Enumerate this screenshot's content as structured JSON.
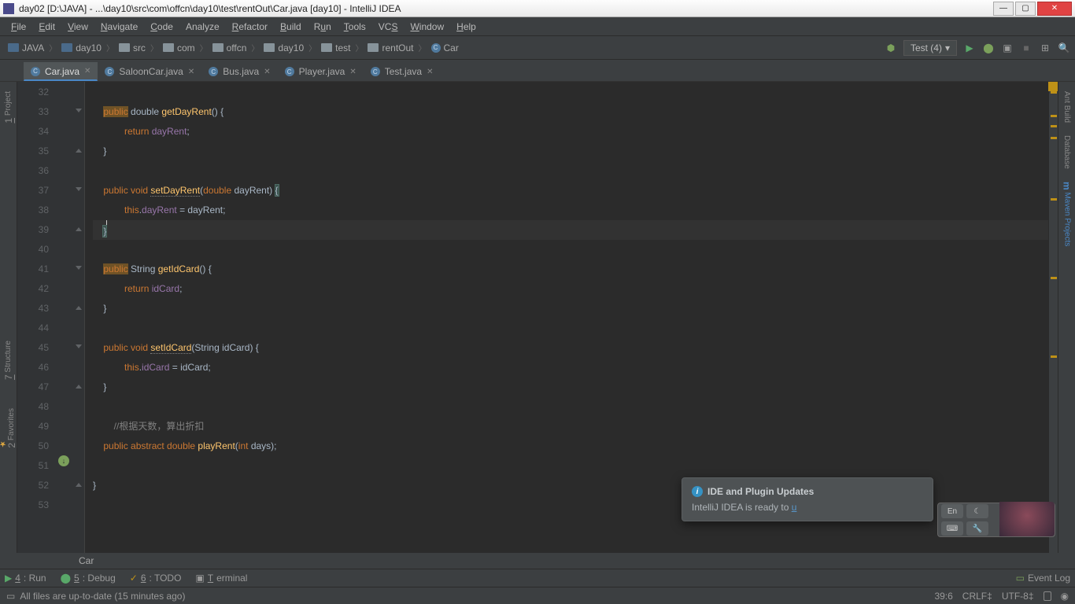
{
  "titlebar": {
    "text": "day02 [D:\\JAVA] - ...\\day10\\src\\com\\offcn\\day10\\test\\rentOut\\Car.java [day10] - IntelliJ IDEA"
  },
  "menubar": [
    {
      "key": "F",
      "label": "File"
    },
    {
      "key": "E",
      "label": "Edit"
    },
    {
      "key": "V",
      "label": "View"
    },
    {
      "key": "N",
      "label": "Navigate"
    },
    {
      "key": "C",
      "label": "Code"
    },
    {
      "key": "",
      "label": "Analyze"
    },
    {
      "key": "R",
      "label": "Refactor"
    },
    {
      "key": "B",
      "label": "Build"
    },
    {
      "key": "u",
      "label": "Run"
    },
    {
      "key": "T",
      "label": "Tools"
    },
    {
      "key": "S",
      "label": "VCS"
    },
    {
      "key": "W",
      "label": "Window"
    },
    {
      "key": "H",
      "label": "Help"
    }
  ],
  "breadcrumbs": [
    "JAVA",
    "day10",
    "src",
    "com",
    "offcn",
    "day10",
    "test",
    "rentOut",
    "Car"
  ],
  "run_config": "Test (4)",
  "tabs": [
    {
      "label": "Car.java",
      "active": true
    },
    {
      "label": "SaloonCar.java",
      "active": false
    },
    {
      "label": "Bus.java",
      "active": false
    },
    {
      "label": "Player.java",
      "active": false
    },
    {
      "label": "Test.java",
      "active": false
    }
  ],
  "lines": {
    "32": "",
    "33": {
      "tokens": [
        {
          "t": "public",
          "c": "kw hl"
        },
        {
          "t": " double ",
          "c": "type"
        },
        {
          "t": "getDayRent",
          "c": "method"
        },
        {
          "t": "() {",
          "c": "paren"
        }
      ]
    },
    "34": {
      "tokens": [
        {
          "t": "        return ",
          "c": "kw"
        },
        {
          "t": "dayRent",
          "c": "ident"
        },
        {
          "t": ";",
          "c": "paren"
        }
      ]
    },
    "35": "    }",
    "36": "",
    "37": {
      "tokens": [
        {
          "t": "public void ",
          "c": "kw"
        },
        {
          "t": "setDayRent",
          "c": "method underline"
        },
        {
          "t": "(",
          "c": "paren"
        },
        {
          "t": "double ",
          "c": "kw"
        },
        {
          "t": "dayRent) ",
          "c": "paren"
        },
        {
          "t": "{",
          "c": "paren caret-brace"
        }
      ]
    },
    "38": {
      "tokens": [
        {
          "t": "        this",
          "c": "this"
        },
        {
          "t": ".",
          "c": "paren"
        },
        {
          "t": "dayRent",
          "c": "ident"
        },
        {
          "t": " = dayRent;",
          "c": "paren"
        }
      ]
    },
    "39": {
      "tokens": [
        {
          "t": "    ",
          "c": ""
        },
        {
          "t": "}",
          "c": "paren caret-brace"
        }
      ],
      "current": true
    },
    "40": "",
    "41": {
      "tokens": [
        {
          "t": "public",
          "c": "kw hl"
        },
        {
          "t": " String ",
          "c": "type"
        },
        {
          "t": "getIdCard",
          "c": "method"
        },
        {
          "t": "() {",
          "c": "paren"
        }
      ]
    },
    "42": {
      "tokens": [
        {
          "t": "        return ",
          "c": "kw"
        },
        {
          "t": "idCard",
          "c": "ident"
        },
        {
          "t": ";",
          "c": "paren"
        }
      ]
    },
    "43": "    }",
    "44": "",
    "45": {
      "tokens": [
        {
          "t": "public void ",
          "c": "kw"
        },
        {
          "t": "setIdCard",
          "c": "method underline"
        },
        {
          "t": "(String idCard) {",
          "c": "paren"
        }
      ]
    },
    "46": {
      "tokens": [
        {
          "t": "        this",
          "c": "this"
        },
        {
          "t": ".",
          "c": "paren"
        },
        {
          "t": "idCard",
          "c": "ident"
        },
        {
          "t": " = idCard;",
          "c": "paren"
        }
      ]
    },
    "47": "    }",
    "48": "",
    "49": {
      "tokens": [
        {
          "t": "    //根据天数，算出折扣",
          "c": "comment"
        }
      ]
    },
    "50": {
      "tokens": [
        {
          "t": "public abstract double ",
          "c": "kw"
        },
        {
          "t": "playRent",
          "c": "method"
        },
        {
          "t": "(",
          "c": "paren"
        },
        {
          "t": "int ",
          "c": "kw"
        },
        {
          "t": "days);",
          "c": "paren"
        }
      ]
    },
    "51": "",
    "52": "}",
    "53": ""
  },
  "line_start": 32,
  "line_end": 53,
  "breadcrumb_bottom": "Car",
  "left_rail": [
    {
      "label": "1: Project",
      "key": "1"
    },
    {
      "label": "7: Structure",
      "key": "7"
    },
    {
      "label": "2: Favorites",
      "key": "2",
      "star": true
    }
  ],
  "right_rail": [
    "Ant Build",
    "Database",
    "Maven Projects"
  ],
  "bottom_tabs": [
    {
      "label": "4: Run",
      "icon": "run"
    },
    {
      "label": "5: Debug",
      "icon": "bug"
    },
    {
      "label": "6: TODO",
      "icon": "todo"
    },
    {
      "label": "Terminal",
      "icon": "term"
    }
  ],
  "event_log": "Event Log",
  "statusbar": {
    "message": "All files are up-to-date (15 minutes ago)",
    "pos": "39:6",
    "sep": "CRLF",
    "enc": "UTF-8"
  },
  "notification": {
    "title": "IDE and Plugin Updates",
    "body_prefix": "IntelliJ IDEA is ready to ",
    "body_link": "u"
  },
  "ime": {
    "lang": "En"
  }
}
